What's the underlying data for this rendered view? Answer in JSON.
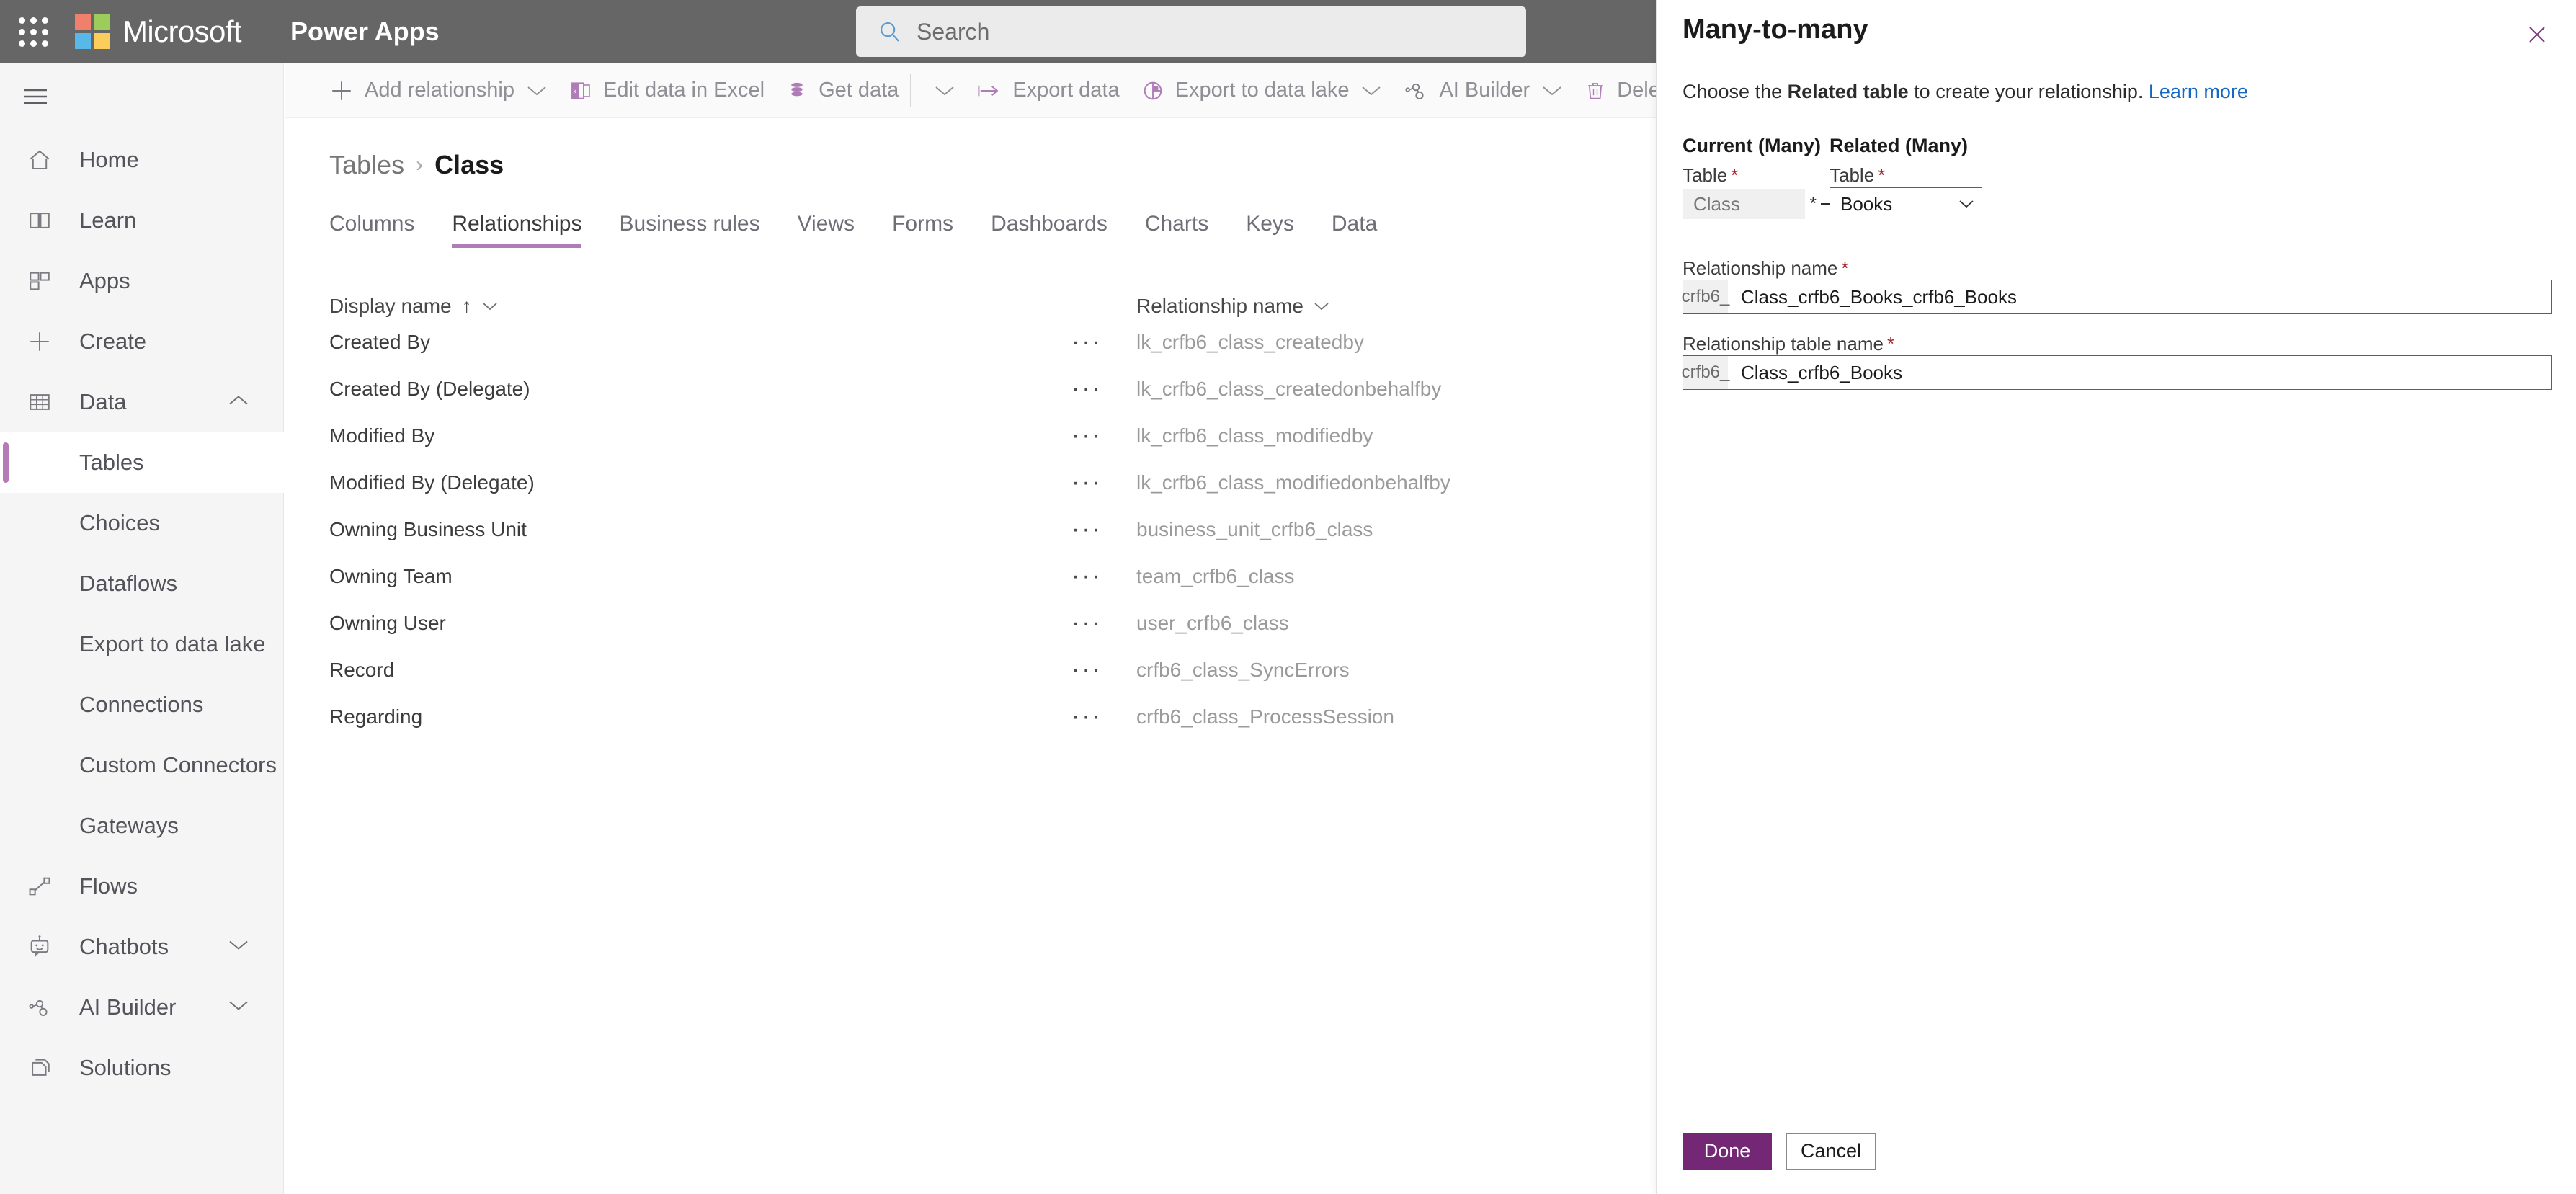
{
  "colors": {
    "topbar_bg": "#666666",
    "accent_purple": "#742774",
    "tab_underline": "#b07cb8",
    "nav_selected_bar": "#b57bb5",
    "link_blue": "#1268c3",
    "required_red": "#a4262c",
    "command_text": "#8f8f96"
  },
  "topbar": {
    "waffle_icon": "waffle-grid-icon",
    "brand": "Microsoft",
    "app_name": "Power Apps",
    "search": {
      "icon": "search-icon",
      "placeholder": "Search",
      "value": ""
    }
  },
  "leftnav": {
    "hamburger_icon": "hamburger-icon",
    "items": [
      {
        "label": "Home",
        "icon": "home-icon",
        "sub": false,
        "chevron": "",
        "selected": false
      },
      {
        "label": "Learn",
        "icon": "book-icon",
        "sub": false,
        "chevron": "",
        "selected": false
      },
      {
        "label": "Apps",
        "icon": "apps-grid-icon",
        "sub": false,
        "chevron": "",
        "selected": false
      },
      {
        "label": "Create",
        "icon": "plus-icon",
        "sub": false,
        "chevron": "",
        "selected": false
      },
      {
        "label": "Data",
        "icon": "table-icon",
        "sub": false,
        "chevron": "chevron-up-icon",
        "selected": false
      },
      {
        "label": "Tables",
        "icon": "",
        "sub": true,
        "chevron": "",
        "selected": true
      },
      {
        "label": "Choices",
        "icon": "",
        "sub": true,
        "chevron": "",
        "selected": false
      },
      {
        "label": "Dataflows",
        "icon": "",
        "sub": true,
        "chevron": "",
        "selected": false
      },
      {
        "label": "Export to data lake",
        "icon": "",
        "sub": true,
        "chevron": "",
        "selected": false
      },
      {
        "label": "Connections",
        "icon": "",
        "sub": true,
        "chevron": "",
        "selected": false
      },
      {
        "label": "Custom Connectors",
        "icon": "",
        "sub": true,
        "chevron": "",
        "selected": false
      },
      {
        "label": "Gateways",
        "icon": "",
        "sub": true,
        "chevron": "",
        "selected": false
      },
      {
        "label": "Flows",
        "icon": "flow-icon",
        "sub": false,
        "chevron": "",
        "selected": false
      },
      {
        "label": "Chatbots",
        "icon": "chatbot-icon",
        "sub": false,
        "chevron": "chevron-down-icon",
        "selected": false
      },
      {
        "label": "AI Builder",
        "icon": "ai-builder-icon",
        "sub": false,
        "chevron": "chevron-down-icon",
        "selected": false
      },
      {
        "label": "Solutions",
        "icon": "solutions-icon",
        "sub": false,
        "chevron": "",
        "selected": false
      }
    ]
  },
  "commandbar": {
    "items": [
      {
        "label": "Add relationship",
        "icon": "plus-icon",
        "chevron": true,
        "separator_after": false
      },
      {
        "label": "Edit data in Excel",
        "icon": "excel-icon",
        "chevron": false,
        "separator_after": false
      },
      {
        "label": "Get data",
        "icon": "database-icon",
        "chevron": false,
        "separator_after": true
      },
      {
        "label": "",
        "icon": "",
        "chevron": true,
        "separator_after": false
      },
      {
        "label": "Export data",
        "icon": "export-icon",
        "chevron": false,
        "separator_after": false
      },
      {
        "label": "Export to data lake",
        "icon": "pie-icon",
        "chevron": true,
        "separator_after": false
      },
      {
        "label": "AI Builder",
        "icon": "ai-builder-icon",
        "chevron": true,
        "separator_after": false
      },
      {
        "label": "Delete tab",
        "icon": "trash-icon",
        "chevron": false,
        "separator_after": false
      }
    ]
  },
  "breadcrumb": {
    "root": "Tables",
    "separator": "›",
    "current": "Class"
  },
  "tabs": [
    {
      "label": "Columns",
      "active": false
    },
    {
      "label": "Relationships",
      "active": true
    },
    {
      "label": "Business rules",
      "active": false
    },
    {
      "label": "Views",
      "active": false
    },
    {
      "label": "Forms",
      "active": false
    },
    {
      "label": "Dashboards",
      "active": false
    },
    {
      "label": "Charts",
      "active": false
    },
    {
      "label": "Keys",
      "active": false
    },
    {
      "label": "Data",
      "active": false
    }
  ],
  "grid": {
    "columns": [
      {
        "label": "Display name",
        "sort": "↑",
        "chevron": "chevron-down-icon"
      },
      {
        "label": "Relationship name",
        "sort": "",
        "chevron": "chevron-down-icon"
      }
    ],
    "row_menu_glyph": "···",
    "rows": [
      {
        "display_name": "Created By",
        "relationship_name": "lk_crfb6_class_createdby"
      },
      {
        "display_name": "Created By (Delegate)",
        "relationship_name": "lk_crfb6_class_createdonbehalfby"
      },
      {
        "display_name": "Modified By",
        "relationship_name": "lk_crfb6_class_modifiedby"
      },
      {
        "display_name": "Modified By (Delegate)",
        "relationship_name": "lk_crfb6_class_modifiedonbehalfby"
      },
      {
        "display_name": "Owning Business Unit",
        "relationship_name": "business_unit_crfb6_class"
      },
      {
        "display_name": "Owning Team",
        "relationship_name": "team_crfb6_class"
      },
      {
        "display_name": "Owning User",
        "relationship_name": "user_crfb6_class"
      },
      {
        "display_name": "Record",
        "relationship_name": "crfb6_class_SyncErrors"
      },
      {
        "display_name": "Regarding",
        "relationship_name": "crfb6_class_ProcessSession"
      }
    ]
  },
  "panel": {
    "title": "Many-to-many",
    "close_icon": "close-icon",
    "description_before": "Choose the ",
    "description_bold": "Related table",
    "description_after": " to create your relationship. ",
    "learn_more": "Learn more",
    "current_group_header": "Current (Many)",
    "related_group_header": "Related (Many)",
    "current_table_label": "Table",
    "related_table_label": "Table",
    "current_table_value": "Class",
    "related_table_value": "Books",
    "related_table_chevron": "chevron-down-icon",
    "cardinality_left": "*",
    "cardinality_right": "*",
    "relationship_name_label": "Relationship name",
    "relationship_name_prefix": "crfb6_",
    "relationship_name_value": "Class_crfb6_Books_crfb6_Books",
    "relationship_table_name_label": "Relationship table name",
    "relationship_table_name_prefix": "crfb6_",
    "relationship_table_name_value": "Class_crfb6_Books",
    "done_label": "Done",
    "cancel_label": "Cancel"
  }
}
